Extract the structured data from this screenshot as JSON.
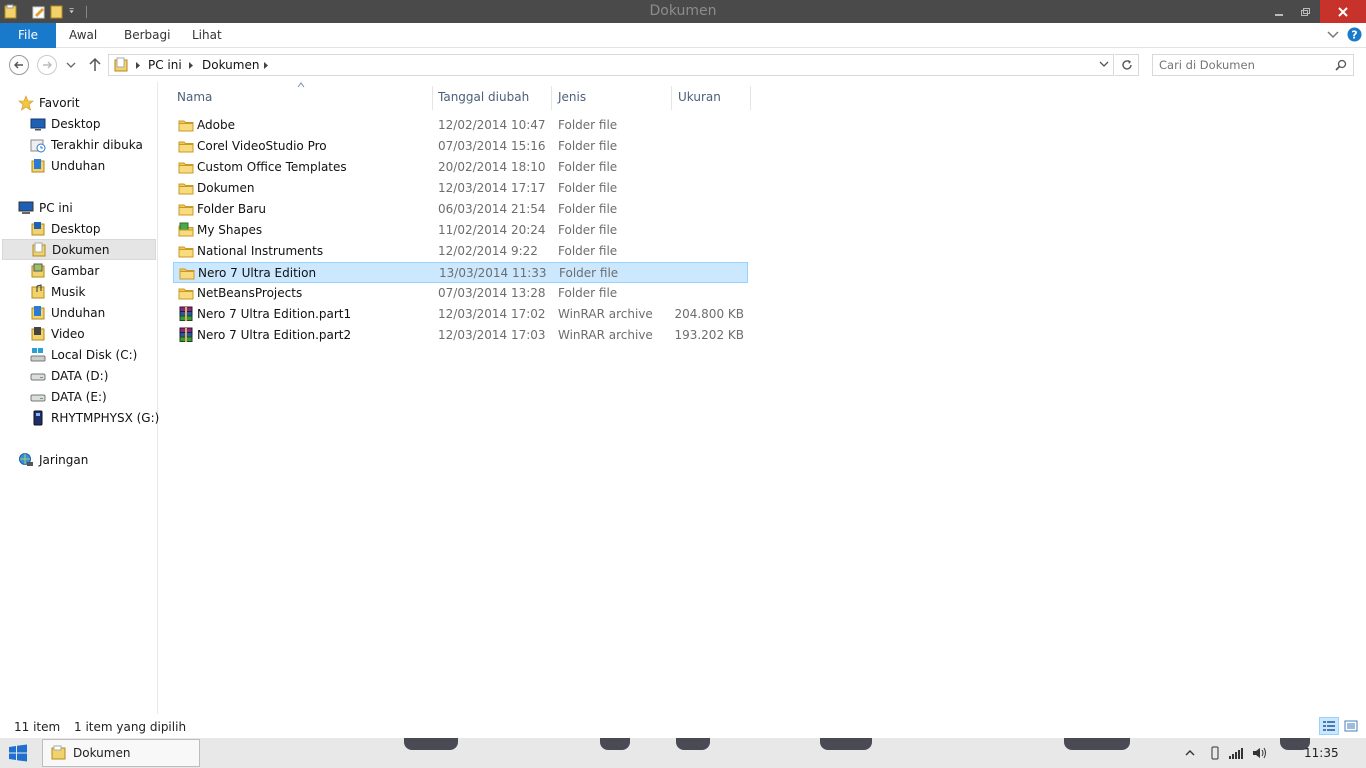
{
  "window": {
    "title": "Dokumen"
  },
  "ribbon": {
    "tabs": [
      {
        "label": "File"
      },
      {
        "label": "Awal"
      },
      {
        "label": "Berbagi"
      },
      {
        "label": "Lihat"
      }
    ]
  },
  "address": {
    "crumbs": [
      "PC ini",
      "Dokumen"
    ]
  },
  "search": {
    "placeholder": "Cari di Dokumen"
  },
  "nav": {
    "favorites": {
      "label": "Favorit",
      "items": [
        "Desktop",
        "Terakhir dibuka",
        "Unduhan"
      ]
    },
    "pc": {
      "label": "PC ini",
      "items": [
        "Desktop",
        "Dokumen",
        "Gambar",
        "Musik",
        "Unduhan",
        "Video",
        "Local Disk (C:)",
        "DATA (D:)",
        "DATA (E:)",
        "RHYTMPHYSX (G:)"
      ]
    },
    "network": {
      "label": "Jaringan"
    }
  },
  "columns": {
    "name": "Nama",
    "date": "Tanggal diubah",
    "type": "Jenis",
    "size": "Ukuran"
  },
  "files": [
    {
      "name": "Adobe",
      "date": "12/02/2014 10:47",
      "type": "Folder file",
      "size": "",
      "icon": "folder"
    },
    {
      "name": "Corel VideoStudio Pro",
      "date": "07/03/2014 15:16",
      "type": "Folder file",
      "size": "",
      "icon": "folder"
    },
    {
      "name": "Custom Office Templates",
      "date": "20/02/2014 18:10",
      "type": "Folder file",
      "size": "",
      "icon": "folder"
    },
    {
      "name": "Dokumen",
      "date": "12/03/2014 17:17",
      "type": "Folder file",
      "size": "",
      "icon": "folder"
    },
    {
      "name": "Folder Baru",
      "date": "06/03/2014 21:54",
      "type": "Folder file",
      "size": "",
      "icon": "folder"
    },
    {
      "name": "My Shapes",
      "date": "11/02/2014 20:24",
      "type": "Folder file",
      "size": "",
      "icon": "shapes-folder"
    },
    {
      "name": "National Instruments",
      "date": "12/02/2014 9:22",
      "type": "Folder file",
      "size": "",
      "icon": "folder"
    },
    {
      "name": "Nero 7 Ultra Edition",
      "date": "13/03/2014 11:33",
      "type": "Folder file",
      "size": "",
      "icon": "folder",
      "selected": true
    },
    {
      "name": "NetBeansProjects",
      "date": "07/03/2014 13:28",
      "type": "Folder file",
      "size": "",
      "icon": "folder"
    },
    {
      "name": "Nero 7 Ultra Edition.part1",
      "date": "12/03/2014 17:02",
      "type": "WinRAR archive",
      "size": "204.800 KB",
      "icon": "winrar"
    },
    {
      "name": "Nero 7 Ultra Edition.part2",
      "date": "12/03/2014 17:03",
      "type": "WinRAR archive",
      "size": "193.202 KB",
      "icon": "winrar"
    }
  ],
  "status": {
    "count": "11 item",
    "selection": "1 item yang dipilih"
  },
  "taskbar": {
    "window_label": "Dokumen",
    "clock": "11:35"
  },
  "colors": {
    "file_tab": "#1979ca",
    "selection": "#cce8ff",
    "selection_border": "#99d1ff",
    "titlebar": "#4a4a4a",
    "close": "#c7332b"
  }
}
